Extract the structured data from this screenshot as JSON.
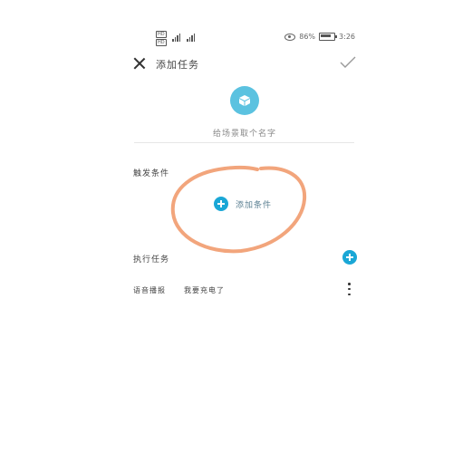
{
  "status_bar": {
    "sim1": "HD",
    "sim2": "HD",
    "network1": "4G",
    "network2": "4G",
    "battery_percent": "86%",
    "time": "3:26"
  },
  "header": {
    "title": "添加任务"
  },
  "task_name": {
    "placeholder": "给场景取个名字"
  },
  "trigger": {
    "label": "触发条件",
    "add_condition_label": "添加条件"
  },
  "actions": {
    "label": "执行任务",
    "items": [
      {
        "type": "语音播报",
        "content": "我要充电了"
      }
    ]
  },
  "colors": {
    "accent": "#1aa7d6",
    "avatar_bg": "#5bc2e0",
    "annotation_stroke": "#f2a57c"
  }
}
